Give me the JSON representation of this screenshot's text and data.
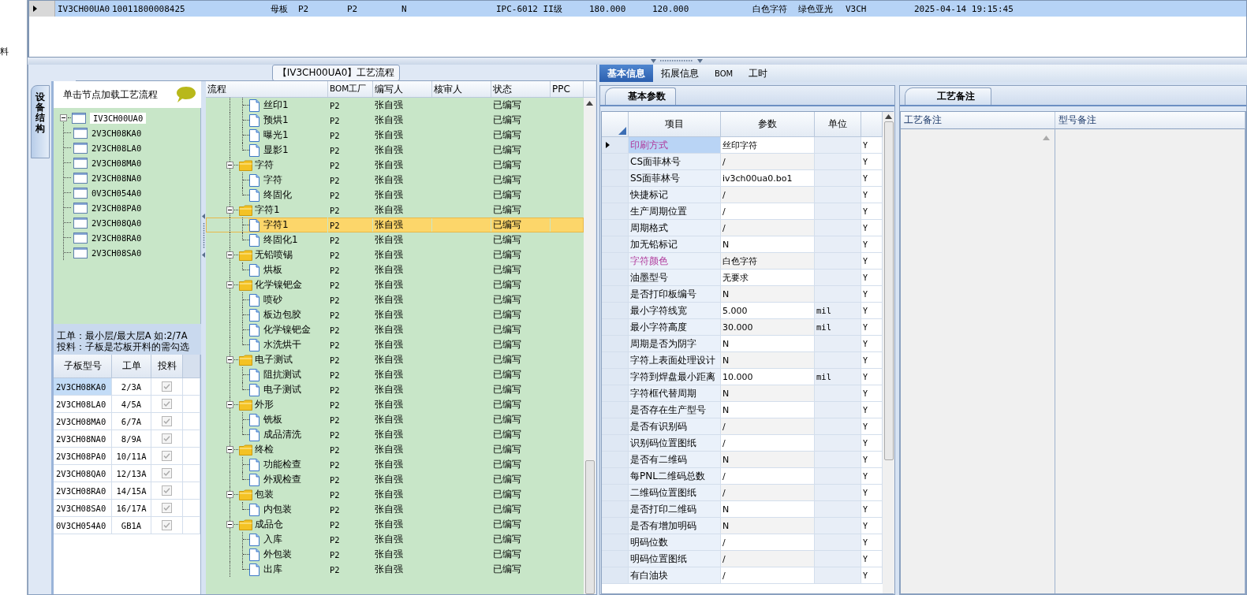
{
  "left_edge_text": "料",
  "top_grid": {
    "rows": [
      {
        "selected": true,
        "cells": [
          "IV3CH00UA0",
          "10011800008425",
          "母板",
          "P2",
          "P2",
          "N",
          "IPC-6012 II级",
          "180.000",
          "120.000",
          "白色字符",
          "绿色亚光",
          "V3CH",
          "2025-04-14 19:15:45"
        ]
      }
    ]
  },
  "process_panel": {
    "title": "【IV3CH00UA0】工艺流程",
    "side_tab": "设备结构",
    "structure_tree": {
      "hint": "单击节点加载工艺流程",
      "root": {
        "label": "IV3CH00UA0",
        "expanded": true,
        "children": [
          {
            "label": "2V3CH08KA0"
          },
          {
            "label": "2V3CH08LA0"
          },
          {
            "label": "2V3CH08MA0"
          },
          {
            "label": "2V3CH08NA0"
          },
          {
            "label": "0V3CH054A0"
          },
          {
            "label": "2V3CH08PA0"
          },
          {
            "label": "2V3CH08QA0"
          },
          {
            "label": "2V3CH08RA0"
          },
          {
            "label": "2V3CH08SA0"
          }
        ]
      }
    },
    "notes": [
      "工单：最小层/最大层A 如:2/7A",
      "投料：子板是芯板开料的需勾选"
    ],
    "board_table": {
      "columns": [
        "子板型号",
        "工单",
        "投料"
      ],
      "rows": [
        {
          "model": "2V3CH08KA0",
          "order": "2/3A",
          "checked": true,
          "selected": true
        },
        {
          "model": "2V3CH08LA0",
          "order": "4/5A",
          "checked": true,
          "selected": false
        },
        {
          "model": "2V3CH08MA0",
          "order": "6/7A",
          "checked": true,
          "selected": false
        },
        {
          "model": "2V3CH08NA0",
          "order": "8/9A",
          "checked": true,
          "selected": false
        },
        {
          "model": "2V3CH08PA0",
          "order": "10/11A",
          "checked": true,
          "selected": false
        },
        {
          "model": "2V3CH08QA0",
          "order": "12/13A",
          "checked": true,
          "selected": false
        },
        {
          "model": "2V3CH08RA0",
          "order": "14/15A",
          "checked": true,
          "selected": false
        },
        {
          "model": "2V3CH08SA0",
          "order": "16/17A",
          "checked": true,
          "selected": false
        },
        {
          "model": "0V3CH054A0",
          "order": "GB1A",
          "checked": true,
          "selected": false
        }
      ]
    },
    "flow_grid": {
      "columns": [
        "流程",
        "BOM工厂",
        "编写人",
        "核审人",
        "状态",
        "PPC"
      ],
      "groups": [
        {
          "children": [
            {
              "name": "丝印1",
              "bom": "P2",
              "writer": "张自强",
              "status": "已编写",
              "selected": false
            },
            {
              "name": "预烘1",
              "bom": "P2",
              "writer": "张自强",
              "status": "已编写",
              "selected": false
            },
            {
              "name": "曝光1",
              "bom": "P2",
              "writer": "张自强",
              "status": "已编写",
              "selected": false
            },
            {
              "name": "显影1",
              "bom": "P2",
              "writer": "张自强",
              "status": "已编写",
              "selected": false
            }
          ]
        },
        {
          "name": "字符",
          "bom": "P2",
          "writer": "张自强",
          "status": "已编写",
          "expanded": true,
          "children": [
            {
              "name": "字符",
              "bom": "P2",
              "writer": "张自强",
              "status": "已编写",
              "selected": false
            },
            {
              "name": "终固化",
              "bom": "P2",
              "writer": "张自强",
              "status": "已编写",
              "selected": false
            }
          ]
        },
        {
          "name": "字符1",
          "bom": "P2",
          "writer": "张自强",
          "status": "已编写",
          "expanded": true,
          "children": [
            {
              "name": "字符1",
              "bom": "P2",
              "writer": "张自强",
              "status": "已编写",
              "selected": true
            },
            {
              "name": "终固化1",
              "bom": "P2",
              "writer": "张自强",
              "status": "已编写",
              "selected": false
            }
          ]
        },
        {
          "name": "无铅喷锡",
          "bom": "P2",
          "writer": "张自强",
          "status": "已编写",
          "expanded": true,
          "children": [
            {
              "name": "烘板",
              "bom": "P2",
              "writer": "张自强",
              "status": "已编写",
              "selected": false
            }
          ]
        },
        {
          "name": "化学镍钯金",
          "bom": "P2",
          "writer": "张自强",
          "status": "已编写",
          "expanded": true,
          "children": [
            {
              "name": "喷砂",
              "bom": "P2",
              "writer": "张自强",
              "status": "已编写",
              "selected": false
            },
            {
              "name": "板边包胶",
              "bom": "P2",
              "writer": "张自强",
              "status": "已编写",
              "selected": false
            },
            {
              "name": "化学镍钯金",
              "bom": "P2",
              "writer": "张自强",
              "status": "已编写",
              "selected": false
            },
            {
              "name": "水洗烘干",
              "bom": "P2",
              "writer": "张自强",
              "status": "已编写",
              "selected": false
            }
          ]
        },
        {
          "name": "电子测试",
          "bom": "P2",
          "writer": "张自强",
          "status": "已编写",
          "expanded": true,
          "children": [
            {
              "name": "阻抗测试",
              "bom": "P2",
              "writer": "张自强",
              "status": "已编写",
              "selected": false
            },
            {
              "name": "电子测试",
              "bom": "P2",
              "writer": "张自强",
              "status": "已编写",
              "selected": false
            }
          ]
        },
        {
          "name": "外形",
          "bom": "P2",
          "writer": "张自强",
          "status": "已编写",
          "expanded": true,
          "children": [
            {
              "name": "铣板",
              "bom": "P2",
              "writer": "张自强",
              "status": "已编写",
              "selected": false
            },
            {
              "name": "成品清洗",
              "bom": "P2",
              "writer": "张自强",
              "status": "已编写",
              "selected": false
            }
          ]
        },
        {
          "name": "终检",
          "bom": "P2",
          "writer": "张自强",
          "status": "已编写",
          "expanded": true,
          "children": [
            {
              "name": "功能检查",
              "bom": "P2",
              "writer": "张自强",
              "status": "已编写",
              "selected": false
            },
            {
              "name": "外观检查",
              "bom": "P2",
              "writer": "张自强",
              "status": "已编写",
              "selected": false
            }
          ]
        },
        {
          "name": "包装",
          "bom": "P2",
          "writer": "张自强",
          "status": "已编写",
          "expanded": true,
          "children": [
            {
              "name": "内包装",
              "bom": "P2",
              "writer": "张自强",
              "status": "已编写",
              "selected": false
            }
          ]
        },
        {
          "name": "成品仓",
          "bom": "P2",
          "writer": "张自强",
          "status": "已编写",
          "expanded": true,
          "children": [
            {
              "name": "入库",
              "bom": "P2",
              "writer": "张自强",
              "status": "已编写",
              "selected": false
            },
            {
              "name": "外包装",
              "bom": "P2",
              "writer": "张自强",
              "status": "已编写",
              "selected": false
            },
            {
              "name": "出库",
              "bom": "P2",
              "writer": "张自强",
              "status": "已编写",
              "selected": false
            }
          ]
        }
      ]
    }
  },
  "detail_panel": {
    "tabs": [
      {
        "label": "基本信息",
        "selected": true
      },
      {
        "label": "拓展信息",
        "selected": false
      },
      {
        "label": "BOM",
        "selected": false
      },
      {
        "label": "工时",
        "selected": false
      }
    ],
    "params": {
      "tab": "基本参数",
      "columns": [
        "项目",
        "参数",
        "单位"
      ],
      "rows": [
        {
          "item": "印刷方式",
          "value": "丝印字符",
          "flag": "Y",
          "marked": true,
          "selected": true
        },
        {
          "item": "CS面菲林号",
          "value": "/",
          "flag": "Y",
          "marked": false,
          "selected": false
        },
        {
          "item": "SS面菲林号",
          "value": "iv3ch00ua0.bo1",
          "flag": "Y",
          "marked": false,
          "selected": false
        },
        {
          "item": "快捷标记",
          "value": "/",
          "flag": "Y",
          "marked": false,
          "selected": false
        },
        {
          "item": "生产周期位置",
          "value": "/",
          "flag": "Y",
          "marked": false,
          "selected": false
        },
        {
          "item": "周期格式",
          "value": "/",
          "flag": "Y",
          "marked": false,
          "selected": false
        },
        {
          "item": "加无铅标记",
          "value": "N",
          "flag": "Y",
          "marked": false,
          "selected": false
        },
        {
          "item": "字符颜色",
          "value": "白色字符",
          "flag": "Y",
          "marked": true,
          "selected": false
        },
        {
          "item": "油墨型号",
          "value": "无要求",
          "flag": "Y",
          "marked": false,
          "selected": false
        },
        {
          "item": "是否打印板编号",
          "value": "N",
          "flag": "Y",
          "marked": false,
          "selected": false
        },
        {
          "item": "最小字符线宽",
          "value": "5.000",
          "unit": "mil",
          "flag": "Y",
          "marked": false,
          "selected": false
        },
        {
          "item": "最小字符高度",
          "value": "30.000",
          "unit": "mil",
          "flag": "Y",
          "marked": false,
          "selected": false
        },
        {
          "item": "周期是否为阴字",
          "value": "N",
          "flag": "Y",
          "marked": false,
          "selected": false
        },
        {
          "item": "字符上表面处理设计",
          "value": "N",
          "flag": "Y",
          "marked": false,
          "selected": false
        },
        {
          "item": "字符到焊盘最小距离",
          "value": "10.000",
          "unit": "mil",
          "flag": "Y",
          "marked": false,
          "selected": false
        },
        {
          "item": "字符框代替周期",
          "value": "N",
          "flag": "Y",
          "marked": false,
          "selected": false
        },
        {
          "item": "是否存在生产型号",
          "value": "N",
          "flag": "Y",
          "marked": false,
          "selected": false
        },
        {
          "item": "是否有识别码",
          "value": "/",
          "flag": "Y",
          "marked": false,
          "selected": false
        },
        {
          "item": "识别码位置图纸",
          "value": "/",
          "flag": "Y",
          "marked": false,
          "selected": false
        },
        {
          "item": "是否有二维码",
          "value": "N",
          "flag": "Y",
          "marked": false,
          "selected": false
        },
        {
          "item": "每PNL二维码总数",
          "value": "/",
          "flag": "Y",
          "marked": false,
          "selected": false
        },
        {
          "item": "二维码位置图纸",
          "value": "/",
          "flag": "Y",
          "marked": false,
          "selected": false
        },
        {
          "item": "是否打印二维码",
          "value": "N",
          "flag": "Y",
          "marked": false,
          "selected": false
        },
        {
          "item": "是否有增加明码",
          "value": "N",
          "flag": "Y",
          "marked": false,
          "selected": false
        },
        {
          "item": "明码位数",
          "value": "/",
          "flag": "Y",
          "marked": false,
          "selected": false
        },
        {
          "item": "明码位置图纸",
          "value": "/",
          "flag": "Y",
          "marked": false,
          "selected": false
        },
        {
          "item": "有白油块",
          "value": "/",
          "flag": "Y",
          "marked": false,
          "selected": false
        }
      ]
    },
    "remarks": {
      "tab": "工艺备注",
      "columns": [
        "工艺备注",
        "型号备注"
      ]
    }
  }
}
